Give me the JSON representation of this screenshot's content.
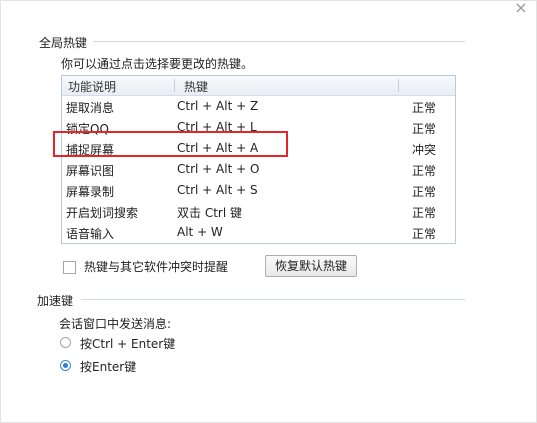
{
  "dialog": {
    "close_glyph": "×",
    "global_hotkeys": {
      "section_title": "全局热键",
      "description": "你可以通过点击选择要更改的热键。",
      "columns": [
        "功能说明",
        "热键"
      ],
      "rows": [
        {
          "name": "提取消息",
          "hotkey": "Ctrl + Alt + Z",
          "status": "正常"
        },
        {
          "name": "锁定QQ",
          "hotkey": "Ctrl + Alt + L",
          "status": "正常"
        },
        {
          "name": "捕捉屏幕",
          "hotkey": "Ctrl + Alt + A",
          "status": "冲突"
        },
        {
          "name": "屏幕识图",
          "hotkey": "Ctrl + Alt + O",
          "status": "正常"
        },
        {
          "name": "屏幕录制",
          "hotkey": "Ctrl + Alt + S",
          "status": "正常"
        },
        {
          "name": "开启划词搜索",
          "hotkey": "双击 Ctrl 键",
          "status": "正常"
        },
        {
          "name": "语音输入",
          "hotkey": "Alt + W",
          "status": "正常"
        }
      ],
      "highlight_color": "#e3262b",
      "conflict_checkbox_label": "热键与其它软件冲突时提醒",
      "conflict_checkbox_checked": false,
      "restore_button": "恢复默认热键"
    },
    "accelerator": {
      "section_title": "加速键",
      "send_label": "会话窗口中发送消息:",
      "options": [
        {
          "label": "按Ctrl + Enter键",
          "selected": false
        },
        {
          "label": "按Enter键",
          "selected": true
        }
      ]
    }
  }
}
